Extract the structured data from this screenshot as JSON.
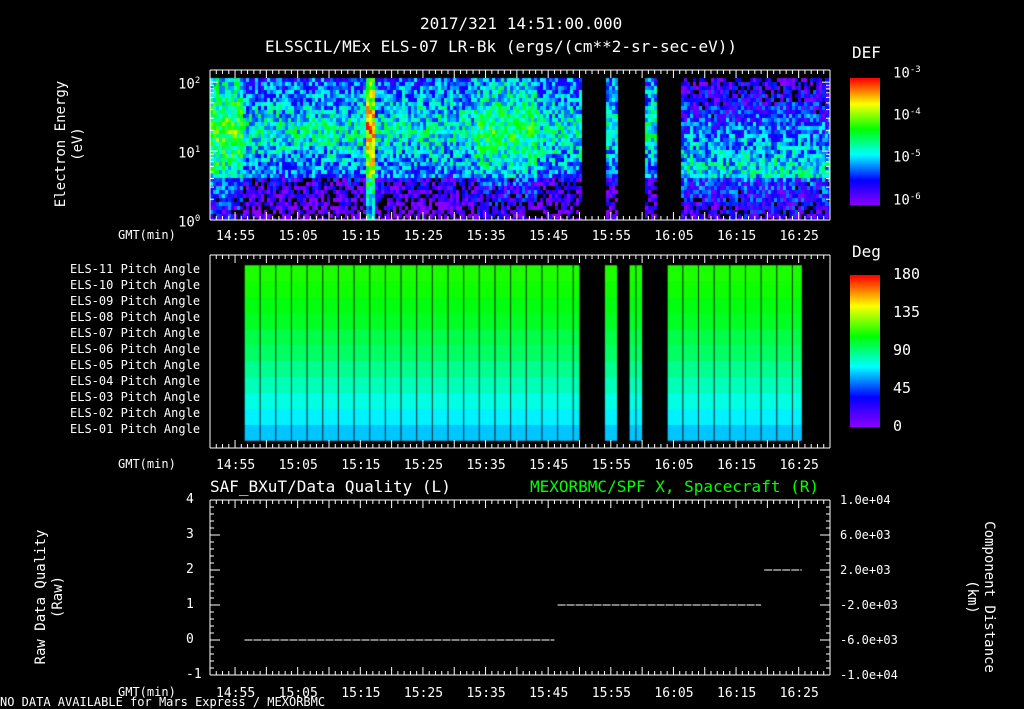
{
  "title": "2017/321 14:51:00.000",
  "time_axis": {
    "label": "GMT(min)",
    "ticks": [
      "14:55",
      "15:05",
      "15:15",
      "15:25",
      "15:35",
      "15:45",
      "15:55",
      "16:05",
      "16:15",
      "16:25"
    ]
  },
  "footer": "NO DATA AVAILABLE for Mars Express / MEXORBMC",
  "chart_data": [
    {
      "type": "heatmap",
      "title": "ELSSCIL/MEx ELS-07 LR-Bk  (ergs/(cm**2-sr-sec-eV))",
      "ylabel": "Electron Energy",
      "yunit": "(eV)",
      "yscale": "log",
      "ylim": [
        1,
        150
      ],
      "yticks": [
        {
          "base": "10",
          "exp": "0"
        },
        {
          "base": "10",
          "exp": "1"
        },
        {
          "base": "10",
          "exp": "2"
        }
      ],
      "xlim_minutes": [
        0,
        99
      ],
      "colorbar": {
        "label": "DEF",
        "ticks": [
          {
            "base": "10",
            "exp": "-3"
          },
          {
            "base": "10",
            "exp": "-4"
          },
          {
            "base": "10",
            "exp": "-5"
          },
          {
            "base": "10",
            "exp": "-6"
          }
        ]
      },
      "data_gaps_minutes": [
        [
          59,
          63
        ],
        [
          65,
          69
        ],
        [
          71,
          75
        ]
      ]
    },
    {
      "type": "heatmap",
      "title": "Pitch Angle",
      "rows": [
        "ELS-11 Pitch Angle",
        "ELS-10 Pitch Angle",
        "ELS-09 Pitch Angle",
        "ELS-08 Pitch Angle",
        "ELS-07 Pitch Angle",
        "ELS-06 Pitch Angle",
        "ELS-05 Pitch Angle",
        "ELS-04 Pitch Angle",
        "ELS-03 Pitch Angle",
        "ELS-02 Pitch Angle",
        "ELS-01 Pitch Angle"
      ],
      "values_deg": [
        112,
        110,
        106,
        103,
        98,
        94,
        88,
        82,
        76,
        70,
        64
      ],
      "data_range_minutes": [
        5.5,
        94.5
      ],
      "data_gaps_minutes": [
        [
          59,
          63
        ],
        [
          65,
          67
        ],
        [
          69,
          73
        ]
      ],
      "colorbar": {
        "label": "Deg",
        "ticks": [
          "180",
          "135",
          "90",
          "45",
          "0"
        ]
      }
    },
    {
      "type": "line",
      "title_left": "SAF_BXuT/Data Quality (L)",
      "title_right": "MEXORBMC/SPF X, Spacecraft (R)",
      "ylabel": "Raw Data Quality",
      "yunit": "(Raw)",
      "ylim": [
        -1,
        4
      ],
      "yticks": [
        "4",
        "3",
        "2",
        "1",
        "0",
        "-1"
      ],
      "y2label": "Component Distance",
      "y2unit": "(km)",
      "y2ticks": [
        "1.0e+04",
        "6.0e+03",
        "2.0e+03",
        "-2.0e+03",
        "-6.0e+03",
        "-1.0e+04"
      ],
      "segments": [
        {
          "x_minutes": [
            5.5,
            55
          ],
          "y": 0
        },
        {
          "x_minutes": [
            55.5,
            88
          ],
          "y": 1
        },
        {
          "x_minutes": [
            88.5,
            94.5
          ],
          "y": 2
        }
      ],
      "right_color": "#00ff00"
    }
  ]
}
